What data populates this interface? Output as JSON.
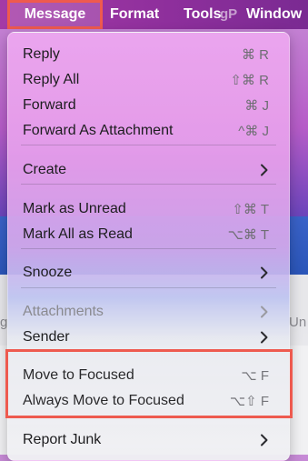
{
  "menubar": {
    "items": [
      "Message",
      "Format",
      "Tools",
      "Window"
    ],
    "watermark": "gP"
  },
  "background": {
    "left_fragment": "g",
    "right_fragment": "Un"
  },
  "menu": {
    "groups": [
      [
        {
          "label": "Reply",
          "shortcut": "⌘ R"
        },
        {
          "label": "Reply All",
          "shortcut": "⇧⌘ R"
        },
        {
          "label": "Forward",
          "shortcut": "⌘ J"
        },
        {
          "label": "Forward As Attachment",
          "shortcut": "^⌘ J"
        }
      ],
      [
        {
          "label": "Create",
          "submenu": true
        }
      ],
      [
        {
          "label": "Mark as Unread",
          "shortcut": "⇧⌘ T"
        },
        {
          "label": "Mark All as Read",
          "shortcut": "⌥⌘ T"
        }
      ],
      [
        {
          "label": "Snooze",
          "submenu": true
        }
      ],
      [
        {
          "label": "Attachments",
          "submenu": true,
          "disabled": true
        },
        {
          "label": "Sender",
          "submenu": true
        }
      ],
      [
        {
          "label": "Move to Focused",
          "shortcut": "⌥ F"
        },
        {
          "label": "Always Move to Focused",
          "shortcut": "⌥⇧ F"
        }
      ],
      [
        {
          "label": "Report Junk",
          "submenu": true
        }
      ]
    ]
  },
  "colors": {
    "highlight_border": "#ee5a4f",
    "menubar": "#8e2f9c"
  }
}
